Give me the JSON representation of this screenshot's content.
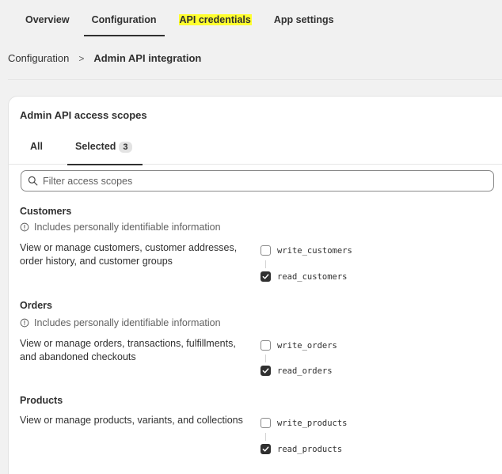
{
  "top_tabs": [
    {
      "label": "Overview"
    },
    {
      "label": "Configuration"
    },
    {
      "label": "API credentials"
    },
    {
      "label": "App settings"
    }
  ],
  "breadcrumb": {
    "parent": "Configuration",
    "separator": ">",
    "current": "Admin API integration"
  },
  "card": {
    "title": "Admin API access scopes",
    "tabs": {
      "all": "All",
      "selected": "Selected",
      "selected_count": "3"
    },
    "filter_placeholder": "Filter access scopes"
  },
  "sections": {
    "customers": {
      "title": "Customers",
      "pii": "Includes personally identifiable information",
      "description": "View or manage customers, customer addresses, order history, and customer groups",
      "write": {
        "label": "write_customers",
        "checked": false
      },
      "read": {
        "label": "read_customers",
        "checked": true
      }
    },
    "orders": {
      "title": "Orders",
      "pii": "Includes personally identifiable information",
      "description": "View or manage orders, transactions, fulfillments, and abandoned checkouts",
      "write": {
        "label": "write_orders",
        "checked": false
      },
      "read": {
        "label": "read_orders",
        "checked": true
      }
    },
    "products": {
      "title": "Products",
      "description": "View or manage products, variants, and collections",
      "write": {
        "label": "write_products",
        "checked": false
      },
      "read": {
        "label": "read_products",
        "checked": true
      }
    }
  },
  "colors": {
    "highlight": "#ffff2f",
    "text": "#303030",
    "muted": "#616161",
    "checkbox_checked": "#303030"
  }
}
